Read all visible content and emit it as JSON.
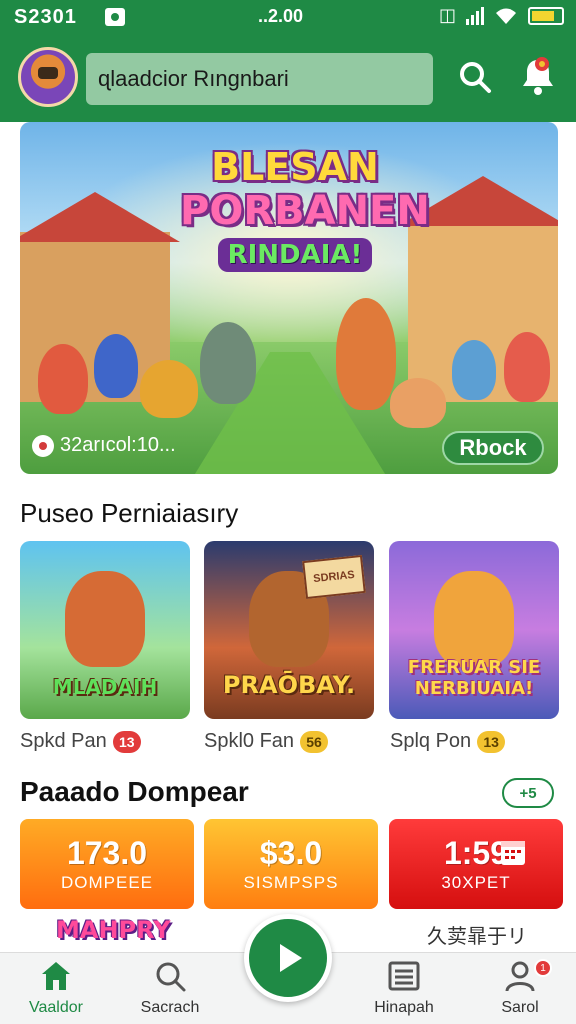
{
  "status_bar": {
    "time": "S2301",
    "center_text": "..2.00"
  },
  "header": {
    "search_text": "ɋlaadcior Rıngnbari"
  },
  "hero": {
    "title_line1": "BLESAN",
    "title_line2": "PORBANEN",
    "title_line3": "RINDAIA!",
    "caption": "32arıcol:10...",
    "button_label": "Rbock"
  },
  "popular": {
    "title": "Puseo Perniaiasıry",
    "tag_text": "SDRIAS",
    "cards": [
      {
        "name": "MLADAIH",
        "meta": "Spkd Pan",
        "badge": "13",
        "badge_color": "#e23b3b"
      },
      {
        "name": "PRAŌBAY.",
        "meta": "Spkl0 Fan",
        "badge": "56",
        "badge_color": "#f2c230"
      },
      {
        "name": "FRERUAR SIE NERBIUAIA!",
        "meta": "Splq Pon",
        "badge": "13",
        "badge_color": "#f2c230"
      }
    ]
  },
  "deals": {
    "title": "Paaado Dompear",
    "toggle_label": "+5",
    "items": [
      {
        "value": "173.0",
        "label": "DOMPEEE"
      },
      {
        "value": "$3.0",
        "label": "SISMPSPS"
      },
      {
        "value": "1:59",
        "label": "30XPET"
      }
    ],
    "promo_logo": "MAHPRY",
    "promo_text": "久荬暃于リ"
  },
  "bottom_nav": {
    "items": [
      {
        "label": "Vaaldor"
      },
      {
        "label": "Sacrach"
      },
      {
        "label": "Hinapah"
      },
      {
        "label": "Sarol"
      }
    ],
    "profile_badge": "1"
  },
  "colors": {
    "brand_green": "#1f8a45",
    "deal_orange": "#ff6d0f",
    "deal_red": "#d50f0f"
  }
}
